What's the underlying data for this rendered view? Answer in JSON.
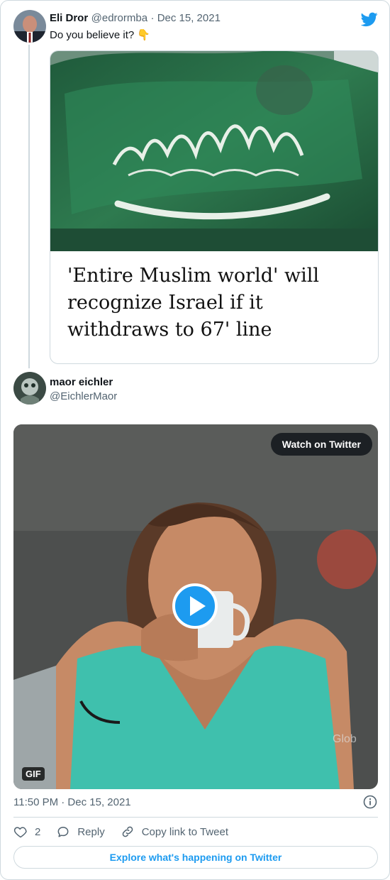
{
  "tweet": {
    "author_name": "Eli Dror",
    "author_handle": "@edrormba",
    "date": "· Dec 15, 2021",
    "text": "Do you believe it? 👇",
    "quote_headline": "'Entire Muslim world' will recognize Israel if it withdraws to 67' line"
  },
  "reply": {
    "author_name": "maor eichler",
    "author_handle": "@EichlerMaor",
    "watch_label": "Watch on Twitter",
    "gif_badge": "GIF",
    "timestamp": "11:50 PM · Dec 15, 2021"
  },
  "actions": {
    "like_count": "2",
    "reply_label": "Reply",
    "copy_link_label": "Copy link to Tweet"
  },
  "footer": {
    "explore_label": "Explore what's happening on Twitter"
  },
  "colors": {
    "accent": "#1d9bf0",
    "text_secondary": "#536471",
    "border": "#cfd9de"
  },
  "icons": [
    "twitter-bird-icon",
    "play-icon",
    "info-icon",
    "heart-icon",
    "reply-bubble-icon",
    "link-icon"
  ]
}
